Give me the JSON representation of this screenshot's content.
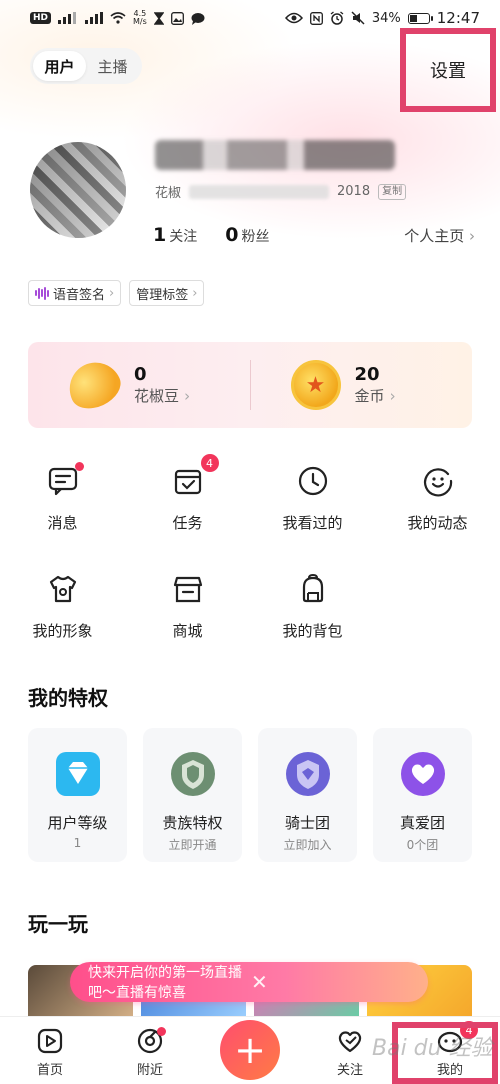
{
  "status_bar": {
    "hd": "HD",
    "net_speed_value": "4.5",
    "net_speed_unit": "M/s",
    "battery": "34%",
    "time": "12:47"
  },
  "header": {
    "tabs": [
      {
        "label": "用户",
        "active": true
      },
      {
        "label": "主播",
        "active": false
      }
    ],
    "settings_label": "设置",
    "highlight_color": "#e0426b"
  },
  "profile": {
    "name_prefix": "花椒",
    "id_suffix": "2018",
    "copy_label": "复制",
    "following_count": "1",
    "following_label": "关注",
    "fans_count": "0",
    "fans_label": "粉丝",
    "homepage_label": "个人主页"
  },
  "chips": [
    {
      "label": "语音签名",
      "icon": "voice-wave-icon"
    },
    {
      "label": "管理标签",
      "icon": ""
    }
  ],
  "wallet": {
    "beans": {
      "value": "0",
      "label": "花椒豆",
      "icon": "bean-icon"
    },
    "coins": {
      "value": "20",
      "label": "金币",
      "icon": "star-coin-icon"
    }
  },
  "menu": [
    {
      "label": "消息",
      "icon": "message-icon",
      "dot": true
    },
    {
      "label": "任务",
      "icon": "task-icon",
      "badge": "4"
    },
    {
      "label": "我看过的",
      "icon": "clock-icon"
    },
    {
      "label": "我的动态",
      "icon": "activity-icon"
    },
    {
      "label": "我的形象",
      "icon": "tshirt-icon"
    },
    {
      "label": "商城",
      "icon": "shop-icon"
    },
    {
      "label": "我的背包",
      "icon": "backpack-icon"
    }
  ],
  "privileges": {
    "title": "我的特权",
    "items": [
      {
        "name": "用户等级",
        "sub": "1",
        "icon": "diamond-icon",
        "color": "#2cb8f0"
      },
      {
        "name": "贵族特权",
        "sub": "立即开通",
        "icon": "noble-shield-icon",
        "color": "#6d8f72"
      },
      {
        "name": "骑士团",
        "sub": "立即加入",
        "icon": "knight-shield-icon",
        "color": "#6b63d6"
      },
      {
        "name": "真爱团",
        "sub": "0个团",
        "icon": "heart-badge-icon",
        "color": "#8d52e8"
      }
    ]
  },
  "play": {
    "title": "玩一玩",
    "toast": "快来开启你的第一场直播吧～直播有惊喜"
  },
  "bottom_nav": [
    {
      "label": "首页",
      "icon": "home-play-icon"
    },
    {
      "label": "附近",
      "icon": "nearby-disc-icon",
      "dot": true
    },
    {
      "label": "",
      "icon": "plus-icon"
    },
    {
      "label": "关注",
      "icon": "heart-icon"
    },
    {
      "label": "我的",
      "icon": "mine-icon",
      "badge": "4"
    }
  ],
  "watermark": "Bai du 经验"
}
